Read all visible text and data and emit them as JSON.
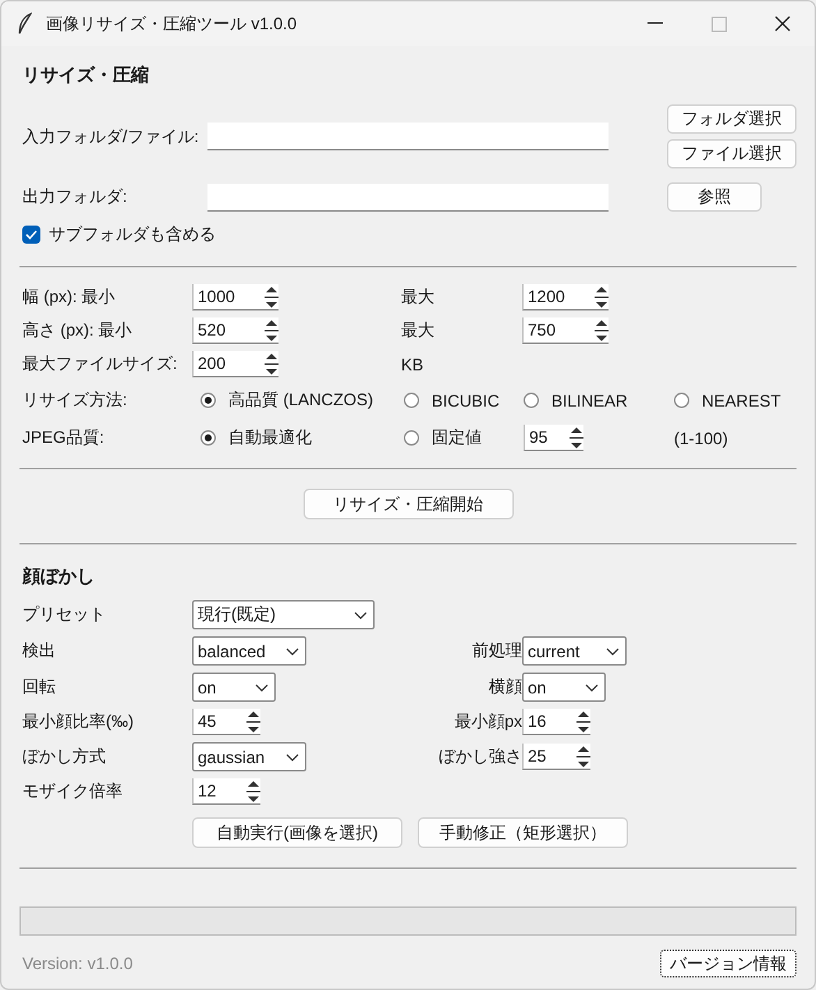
{
  "window": {
    "title": "画像リサイズ・圧縮ツール v1.0.0"
  },
  "resize": {
    "heading": "リサイズ・圧縮",
    "input_label": "入力フォルダ/ファイル:",
    "folder_button": "フォルダ選択",
    "file_button": "ファイル選択",
    "output_label": "出力フォルダ:",
    "browse_button": "参照",
    "include_subfolders": {
      "label": "サブフォルダも含める",
      "checked": true
    }
  },
  "size_rows": [
    {
      "label": "幅 (px): 最小",
      "min": "1000",
      "max_label": "最大",
      "max": "1200"
    },
    {
      "label": "高さ (px): 最小",
      "min": "520",
      "max_label": "最大",
      "max": "750"
    }
  ],
  "max_file_size": {
    "label": "最大ファイルサイズ:",
    "value": "200",
    "unit": "KB"
  },
  "resize_method": {
    "label": "リサイズ方法:",
    "options": [
      {
        "label": "高品質 (LANCZOS)",
        "selected": true
      },
      {
        "label": "BICUBIC",
        "selected": false
      },
      {
        "label": "BILINEAR",
        "selected": false
      },
      {
        "label": "NEAREST",
        "selected": false
      }
    ]
  },
  "jpeg_quality": {
    "label": "JPEG品質:",
    "options": [
      {
        "label": "自動最適化",
        "selected": true
      },
      {
        "label": "固定値",
        "selected": false
      }
    ],
    "fixed_value": "95",
    "range": "(1-100)"
  },
  "start_button": "リサイズ・圧縮開始",
  "face_blur": {
    "heading": "顔ぼかし",
    "rows": [
      {
        "label": "プリセット",
        "kind": "wide",
        "value": "現行(既定)"
      },
      {
        "label": "検出",
        "kind": "dropdown",
        "value": "balanced",
        "right": {
          "label": "前処理",
          "kind": "dropdown",
          "value": "current"
        }
      },
      {
        "label": "回転",
        "kind": "dropdown",
        "value": "on",
        "right": {
          "label": "横顔",
          "kind": "dropdown",
          "value": "on"
        }
      },
      {
        "label": "最小顔比率(‰)",
        "kind": "spin",
        "value": "45",
        "right": {
          "label": "最小顔px",
          "kind": "spin",
          "value": "16"
        }
      },
      {
        "label": "ぼかし方式",
        "kind": "dropdown",
        "value": "gaussian",
        "right": {
          "label": "ぼかし強さ",
          "kind": "spin",
          "value": "25"
        }
      },
      {
        "label": "モザイク倍率",
        "kind": "spin",
        "value": "12"
      }
    ],
    "auto_button": "自動実行(画像を選択)",
    "manual_button": "手動修正（矩形選択）"
  },
  "footer": {
    "progress": {
      "level": 0
    },
    "version": "Version: v1.0.0",
    "version_button": "バージョン情報"
  }
}
